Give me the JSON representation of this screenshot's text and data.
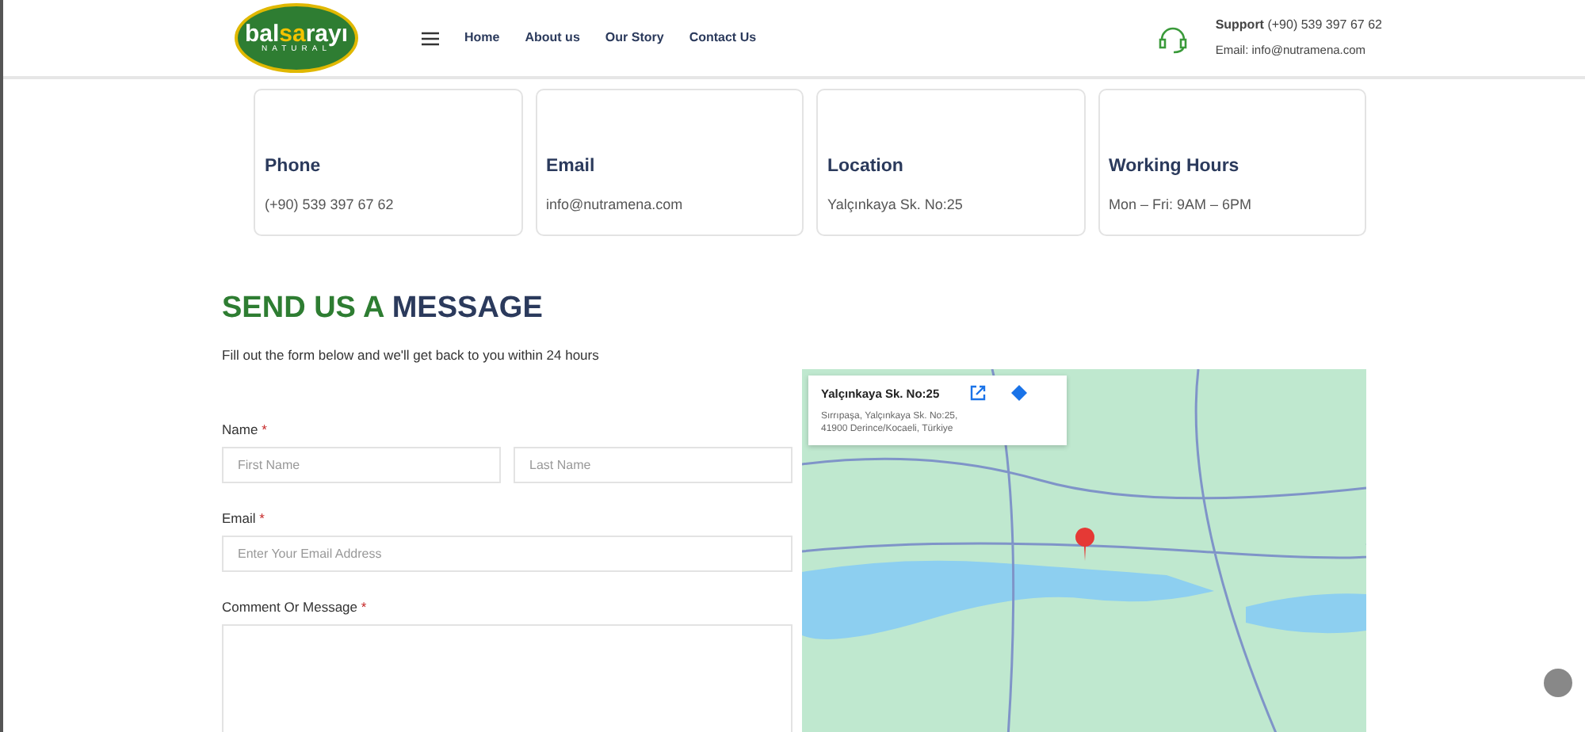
{
  "header": {
    "logo": {
      "parts": [
        "bal",
        "sa",
        "rayı"
      ],
      "tagline": "NATURAL"
    },
    "nav": [
      {
        "label": "Home"
      },
      {
        "label": "About us"
      },
      {
        "label": "Our Story"
      },
      {
        "label": "Contact Us"
      }
    ],
    "support": {
      "label": "Support",
      "phone": "(+90) 539 397 67 62",
      "email": "Email: info@nutramena.com"
    }
  },
  "info_cards": [
    {
      "title": "Phone",
      "value": "(+90) 539 397 67 62"
    },
    {
      "title": "Email",
      "value": "info@nutramena.com"
    },
    {
      "title": "Location",
      "value": "Yalçınkaya Sk. No:25"
    },
    {
      "title": "Working Hours",
      "value": "Mon – Fri: 9AM – 6PM"
    }
  ],
  "form": {
    "heading": [
      "SEND US A",
      "MESSAGE"
    ],
    "intro": "Fill out the form below and we'll get back to you within 24 hours",
    "fields": [
      {
        "label": "Name",
        "required_mark": "*",
        "kind": "pair",
        "inputs": [
          {
            "placeholder": "First Name"
          },
          {
            "placeholder": "Last Name"
          }
        ]
      },
      {
        "label": "Email",
        "required_mark": "*",
        "kind": "single",
        "inputs": [
          {
            "placeholder": "Enter Your Email Address"
          }
        ]
      },
      {
        "label": "Comment Or Message",
        "required_mark": "*",
        "kind": "textarea"
      }
    ]
  },
  "map": {
    "place_title": "Yalçınkaya Sk. No:25",
    "address": [
      "Sırrıpaşa, Yalçınkaya Sk. No:25,",
      "41900 Derince/Kocaeli, Türkiye"
    ]
  }
}
